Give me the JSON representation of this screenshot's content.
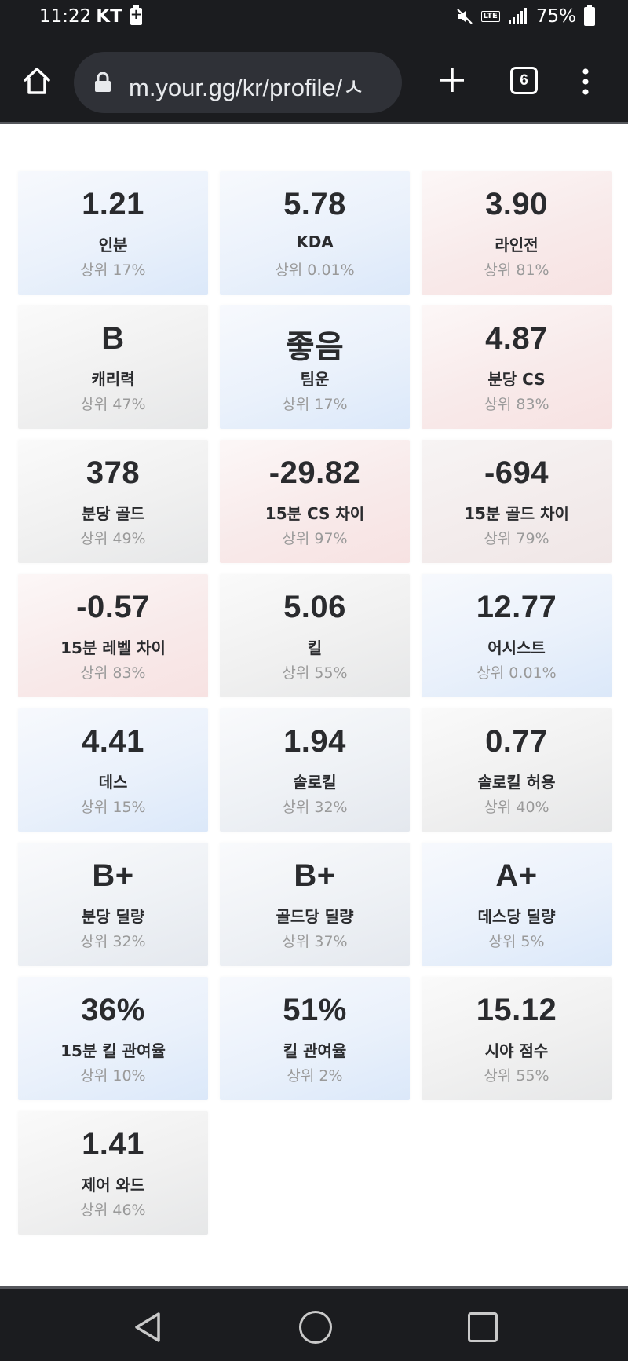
{
  "status": {
    "time": "11:22",
    "carrier": "KT",
    "battery": "75%"
  },
  "browser": {
    "url": "m.your.gg/kr/profile/ㅅ",
    "tab_count": "6"
  },
  "stats": [
    {
      "value": "1.21",
      "label": "인분",
      "rank": "상위 17%",
      "tone": "blue"
    },
    {
      "value": "5.78",
      "label": "KDA",
      "rank": "상위 0.01%",
      "tone": "blue"
    },
    {
      "value": "3.90",
      "label": "라인전",
      "rank": "상위 81%",
      "tone": "red"
    },
    {
      "value": "B",
      "label": "캐리력",
      "rank": "상위 47%",
      "tone": "gray"
    },
    {
      "value": "좋음",
      "label": "팀운",
      "rank": "상위 17%",
      "tone": "blue"
    },
    {
      "value": "4.87",
      "label": "분당 CS",
      "rank": "상위 83%",
      "tone": "red"
    },
    {
      "value": "378",
      "label": "분당 골드",
      "rank": "상위 49%",
      "tone": "gray"
    },
    {
      "value": "-29.82",
      "label": "15분 CS 차이",
      "rank": "상위 97%",
      "tone": "red"
    },
    {
      "value": "-694",
      "label": "15분 골드 차이",
      "rank": "상위 79%",
      "tone": "redgray"
    },
    {
      "value": "-0.57",
      "label": "15분 레벨 차이",
      "rank": "상위 83%",
      "tone": "red"
    },
    {
      "value": "5.06",
      "label": "킬",
      "rank": "상위 55%",
      "tone": "gray"
    },
    {
      "value": "12.77",
      "label": "어시스트",
      "rank": "상위 0.01%",
      "tone": "blue"
    },
    {
      "value": "4.41",
      "label": "데스",
      "rank": "상위 15%",
      "tone": "blue"
    },
    {
      "value": "1.94",
      "label": "솔로킬",
      "rank": "상위 32%",
      "tone": "bluegray"
    },
    {
      "value": "0.77",
      "label": "솔로킬 허용",
      "rank": "상위 40%",
      "tone": "gray"
    },
    {
      "value": "B+",
      "label": "분당 딜량",
      "rank": "상위 32%",
      "tone": "bluegray"
    },
    {
      "value": "B+",
      "label": "골드당 딜량",
      "rank": "상위 37%",
      "tone": "bluegray"
    },
    {
      "value": "A+",
      "label": "데스당 딜량",
      "rank": "상위 5%",
      "tone": "blue"
    },
    {
      "value": "36%",
      "label": "15분 킬 관여율",
      "rank": "상위 10%",
      "tone": "blue"
    },
    {
      "value": "51%",
      "label": "킬 관여율",
      "rank": "상위 2%",
      "tone": "blue"
    },
    {
      "value": "15.12",
      "label": "시야 점수",
      "rank": "상위 55%",
      "tone": "gray"
    },
    {
      "value": "1.41",
      "label": "제어 와드",
      "rank": "상위 46%",
      "tone": "gray"
    }
  ]
}
